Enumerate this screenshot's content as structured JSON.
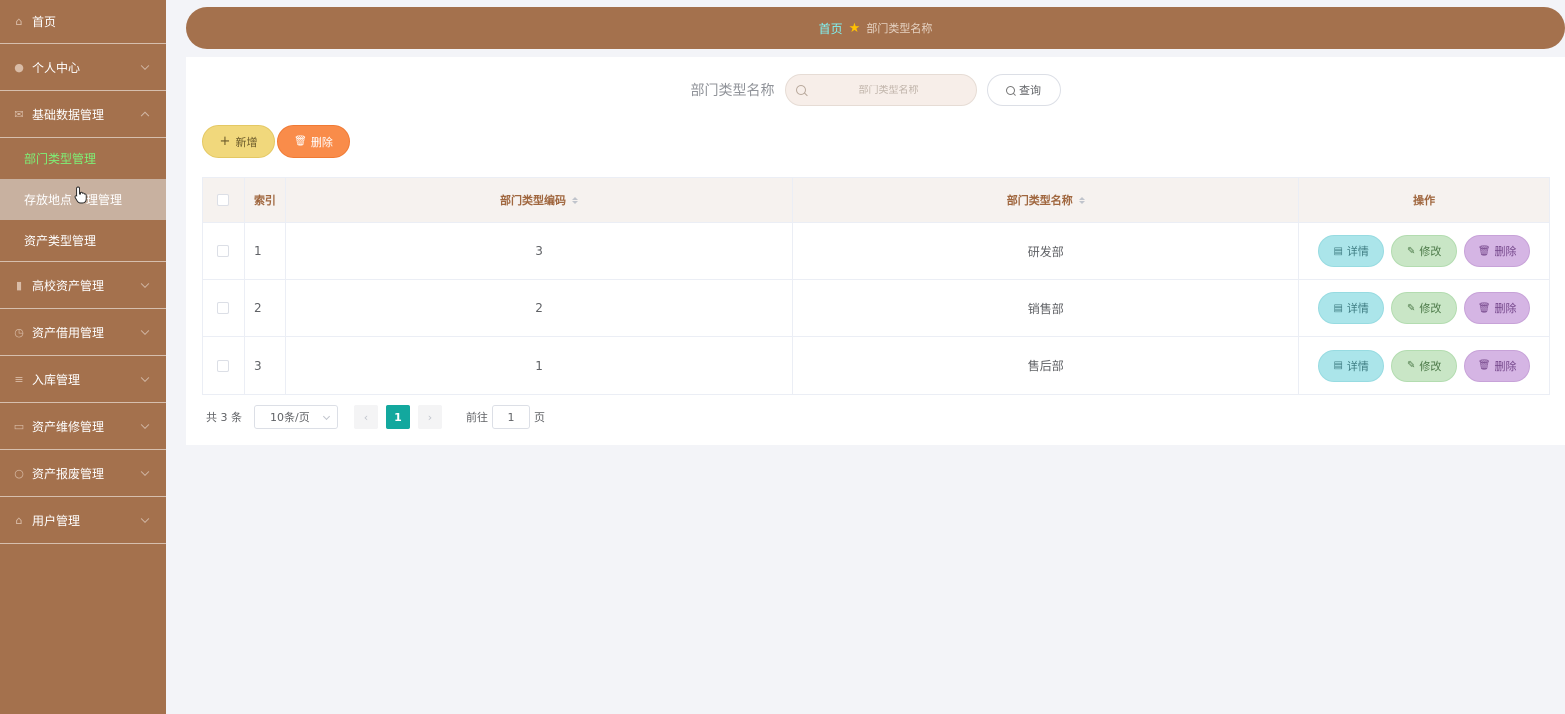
{
  "colors": {
    "sidebar_bg": "#a4714d",
    "active_submenu": "#7ef076",
    "pager_active": "#13a89e",
    "add_button": "#f1d87c",
    "delete_button": "#f98c4a"
  },
  "sidebar": {
    "items": [
      {
        "label": "首页",
        "icon": "home-icon"
      },
      {
        "label": "个人中心",
        "icon": "user-icon"
      },
      {
        "label": "基础数据管理",
        "icon": "mail-icon",
        "expanded": true,
        "children": [
          "部门类型管理",
          "存放地点类型管理",
          "资产类型管理"
        ]
      },
      {
        "label": "高校资产管理",
        "icon": "bar-chart-icon"
      },
      {
        "label": "资产借用管理",
        "icon": "clock-icon"
      },
      {
        "label": "入库管理",
        "icon": "list-icon"
      },
      {
        "label": "资产维修管理",
        "icon": "message-icon"
      },
      {
        "label": "资产报废管理",
        "icon": "power-icon"
      },
      {
        "label": "用户管理",
        "icon": "bank-icon"
      }
    ],
    "sub_visible": [
      "部门类型管理",
      "存放地点",
      "理管理",
      "资产类型管理"
    ]
  },
  "breadcrumb": {
    "home": "首页",
    "current": "部门类型名称"
  },
  "search": {
    "label": "部门类型名称",
    "placeholder": "部门类型名称",
    "button": "查询"
  },
  "actions": {
    "add": "新增",
    "delete": "删除"
  },
  "table": {
    "headers": {
      "index": "索引",
      "code": "部门类型编码",
      "name": "部门类型名称",
      "ops": "操作"
    },
    "rows": [
      {
        "index": "1",
        "code": "3",
        "name": "研发部"
      },
      {
        "index": "2",
        "code": "2",
        "name": "销售部"
      },
      {
        "index": "3",
        "code": "1",
        "name": "售后部"
      }
    ],
    "row_buttons": {
      "detail": "详情",
      "edit": "修改",
      "delete": "删除"
    }
  },
  "pager": {
    "total": "共 3 条",
    "page_size": "10条/页",
    "current": "1",
    "goto_label": "前往",
    "goto_value": "1",
    "page_unit": "页"
  }
}
